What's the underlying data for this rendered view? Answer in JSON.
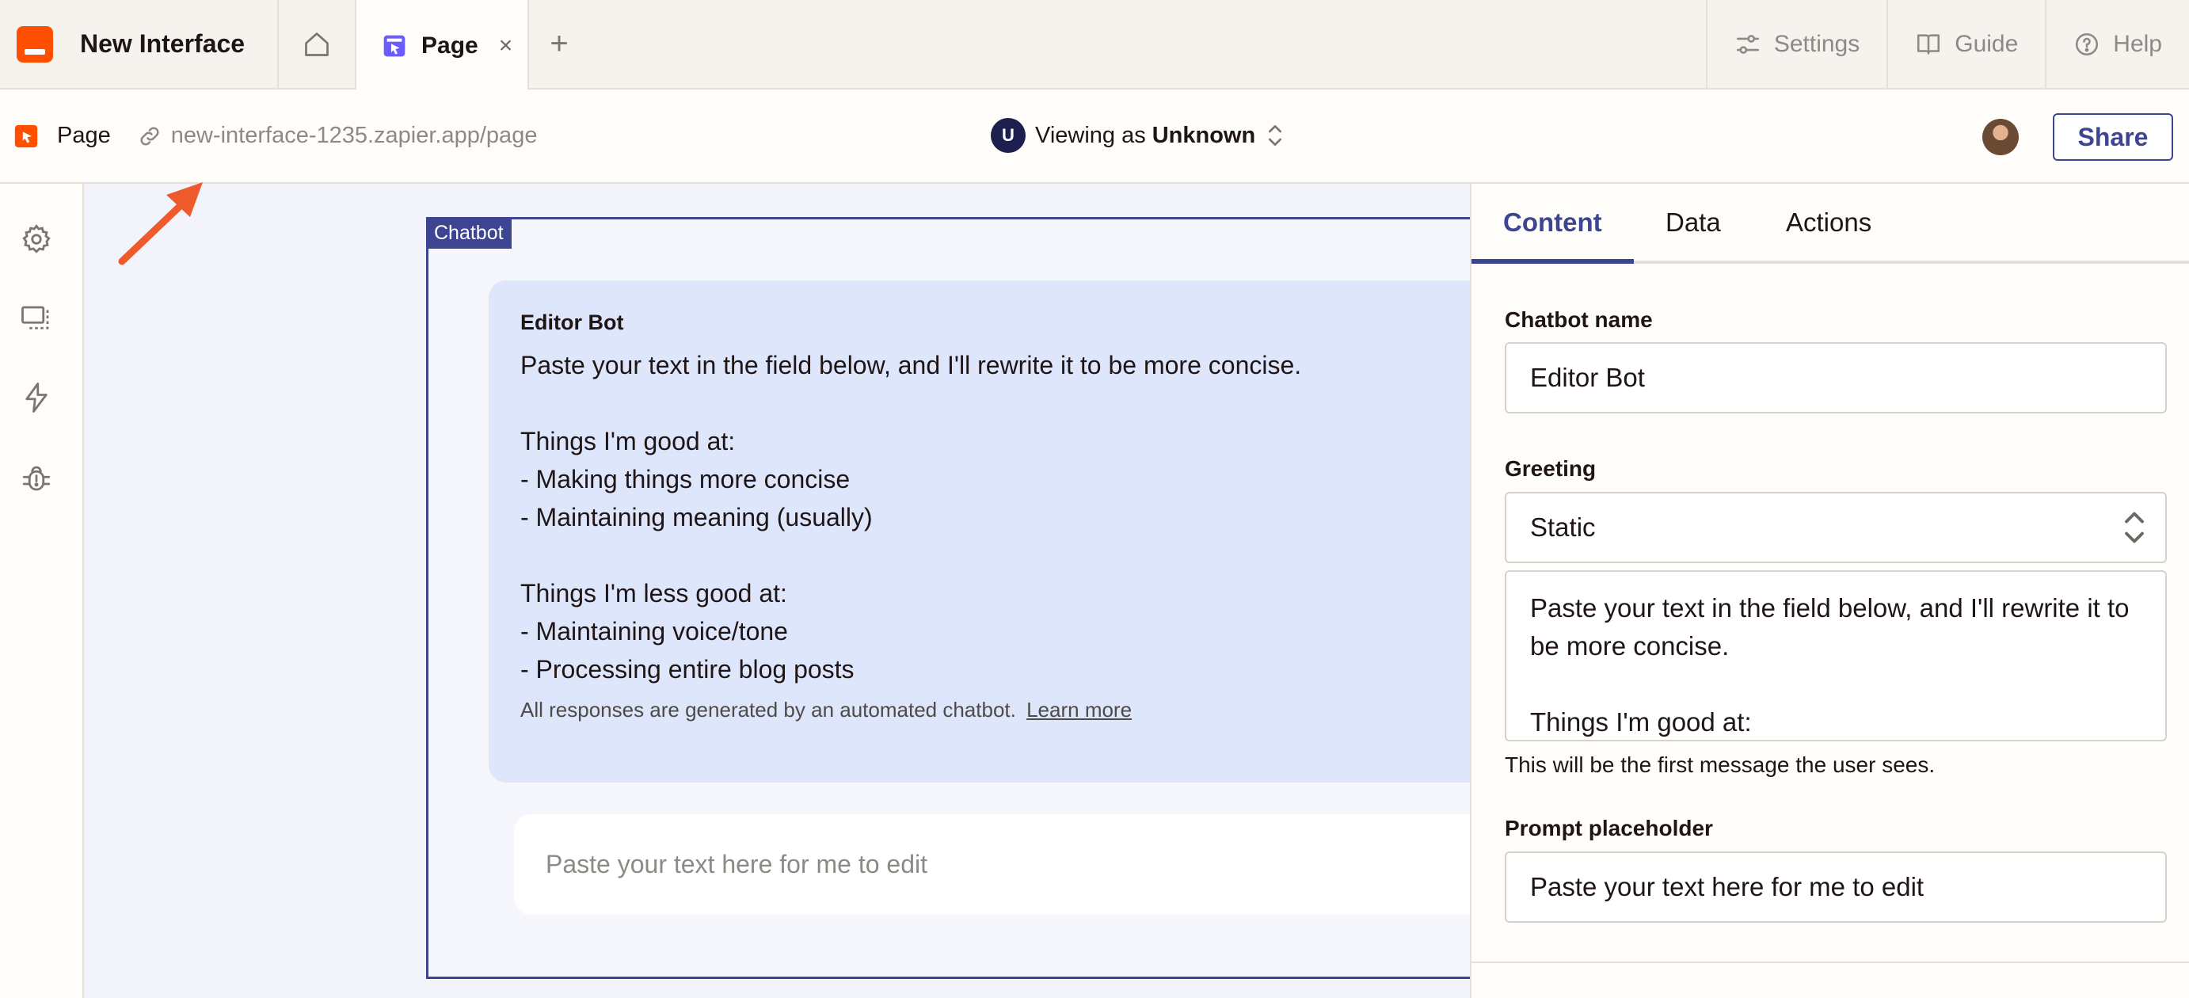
{
  "app": {
    "title": "New Interface",
    "brand_color": "#ff4f00",
    "accent_color": "#3d4592"
  },
  "tabs": {
    "home_icon": "home-icon",
    "active_tab": {
      "label": "Page",
      "icon": "page-icon",
      "close": "×"
    },
    "add": "+",
    "actions": [
      {
        "label": "Settings",
        "icon": "sliders-icon"
      },
      {
        "label": "Guide",
        "icon": "book-icon"
      },
      {
        "label": "Help",
        "icon": "help-icon"
      }
    ]
  },
  "toolbar": {
    "page_label": "Page",
    "url": "new-interface-1235.zapier.app/page",
    "viewing": {
      "avatar_initial": "U",
      "prefix": "Viewing as",
      "name": "Unknown"
    },
    "share_label": "Share"
  },
  "rail": {
    "icons": [
      "gear-icon",
      "layout-icon",
      "lightning-icon",
      "bug-icon"
    ]
  },
  "chatbot": {
    "tag": "Chatbot",
    "bot_name": "Editor Bot",
    "greeting": "Paste your text in the field below, and I'll rewrite it to be more concise.\n\nThings I'm good at:\n- Making things more concise\n- Maintaining meaning (usually)\n\nThings I'm less good at:\n- Maintaining voice/tone\n- Processing entire blog posts",
    "disclaimer": "All responses are generated by an automated chatbot.",
    "learn_more": "Learn more",
    "prompt_placeholder": "Paste your text here for me to edit"
  },
  "panel": {
    "tabs": [
      "Content",
      "Data",
      "Actions"
    ],
    "active_tab": "Content",
    "chatbot_name_label": "Chatbot name",
    "chatbot_name_value": "Editor Bot",
    "greeting_label": "Greeting",
    "greeting_mode": "Static",
    "greeting_preview": "Paste your text in the field below, and I'll rewrite it to be more concise.\n\nThings I'm good at:",
    "greeting_help": "This will be the first message the user sees.",
    "prompt_label": "Prompt placeholder",
    "prompt_value": "Paste your text here for me to edit"
  }
}
